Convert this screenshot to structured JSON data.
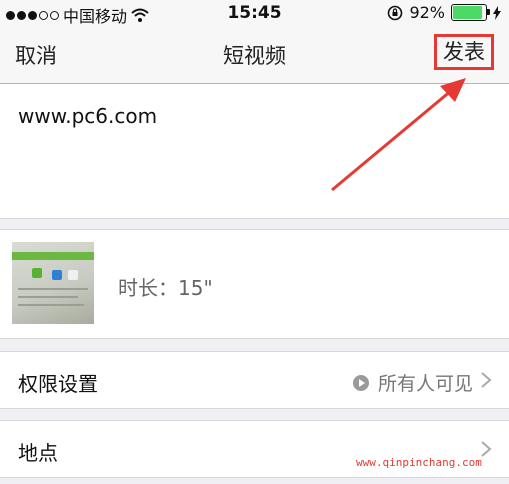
{
  "status_bar": {
    "carrier": "中国移动",
    "time": "15:45",
    "battery_percent": "92%",
    "battery_level": 0.92,
    "signal_bars": 3
  },
  "navbar": {
    "cancel_label": "取消",
    "title": "短视频",
    "publish_label": "发表"
  },
  "post_text": "www.pc6.com",
  "video": {
    "duration_label": "时长：15\""
  },
  "settings": {
    "permission_label": "权限设置",
    "permission_value": "所有人可见",
    "location_label": "地点"
  },
  "watermark": "www.qinpinchang.com",
  "colors": {
    "highlight_red": "#e53935",
    "battery_green": "#4cd964"
  }
}
